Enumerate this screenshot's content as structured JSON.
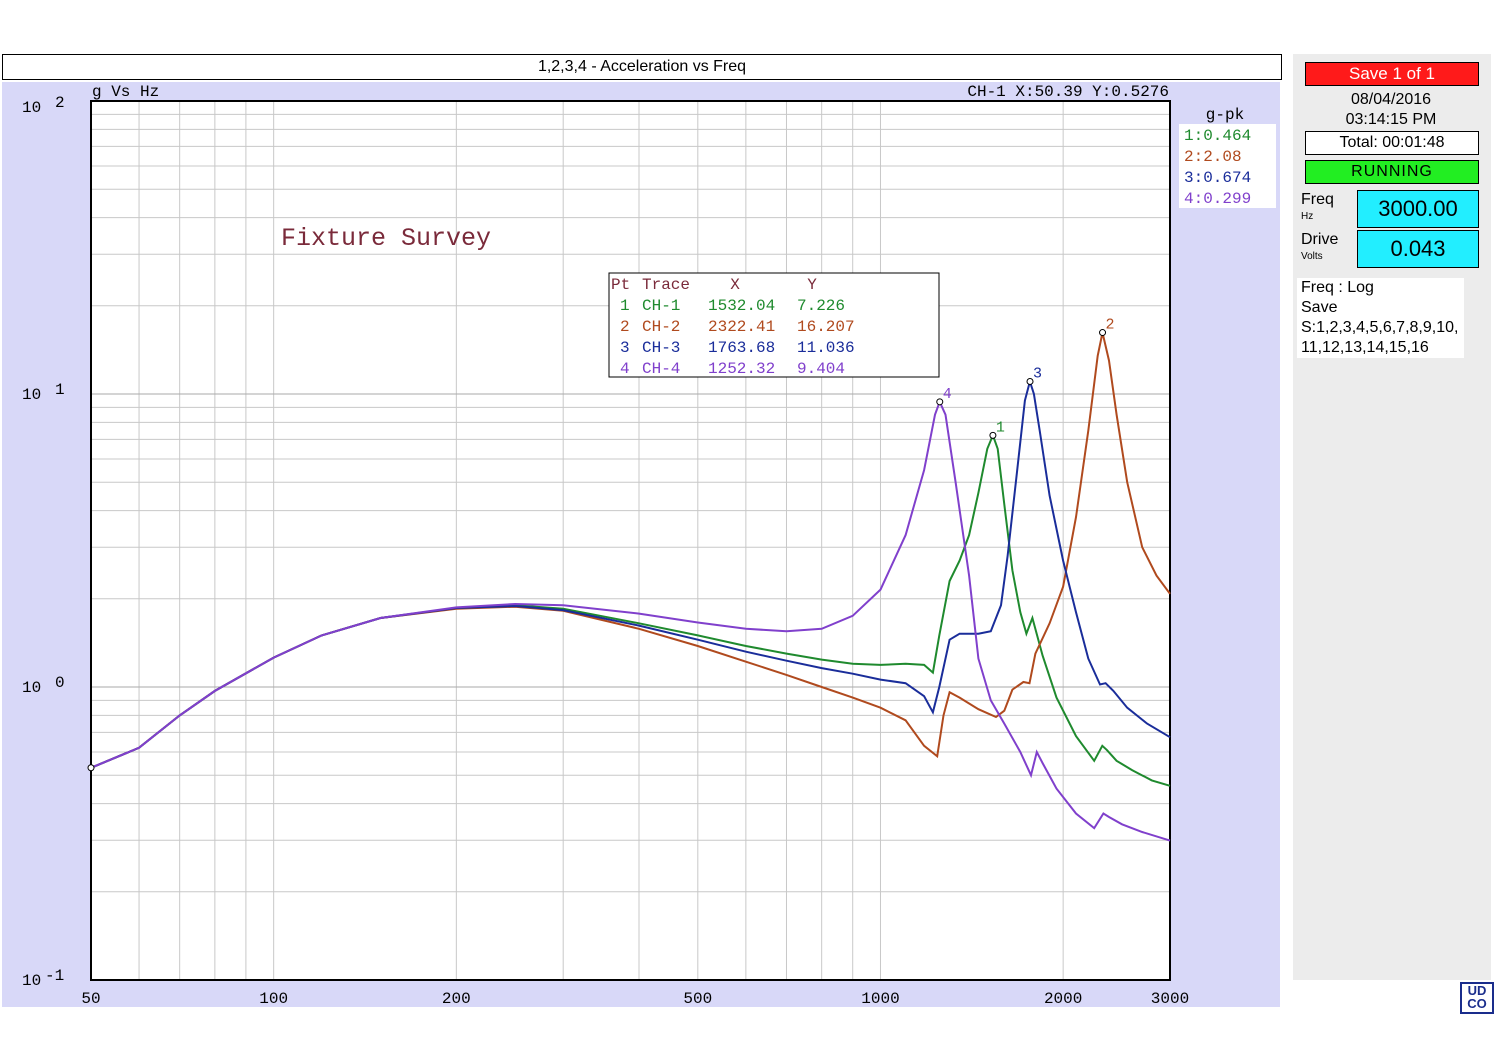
{
  "window_title": "1,2,3,4 - Acceleration vs Freq",
  "chart_data": {
    "type": "line",
    "xscale": "log",
    "yscale": "log",
    "xlim": [
      50,
      3000
    ],
    "ylim": [
      0.1,
      100
    ],
    "xticks": [
      "50",
      "100",
      "200",
      "500",
      "1000",
      "2000",
      "3000"
    ],
    "yticks": [
      {
        "base": "10",
        "exp": "-1"
      },
      {
        "base": "10",
        "exp": "0"
      },
      {
        "base": "10",
        "exp": "1"
      },
      {
        "base": "10",
        "exp": "2"
      }
    ],
    "axis_title": "g Vs Hz",
    "cursor_readout": "CH-1 X:50.39 Y:0.5276",
    "annotation": "Fixture Survey",
    "grid": true,
    "legend": {
      "title": "g-pk",
      "placement": "right",
      "entries": [
        "1:0.464",
        "2:2.08",
        "3:0.674",
        "4:0.299"
      ]
    },
    "peak_table": {
      "headers": [
        "Pt",
        "Trace",
        "X",
        "Y"
      ],
      "rows": [
        [
          "1",
          "CH-1",
          "1532.04",
          "7.226"
        ],
        [
          "2",
          "CH-2",
          "2322.41",
          "16.207"
        ],
        [
          "3",
          "CH-3",
          "1763.68",
          "11.036"
        ],
        [
          "4",
          "CH-4",
          "1252.32",
          "9.404"
        ]
      ]
    },
    "series": [
      {
        "name": "CH-1",
        "color": "#1f8a2e",
        "marker_label": "1",
        "points": [
          [
            50,
            0.53
          ],
          [
            60,
            0.62
          ],
          [
            70,
            0.8
          ],
          [
            80,
            0.97
          ],
          [
            100,
            1.26
          ],
          [
            120,
            1.5
          ],
          [
            150,
            1.72
          ],
          [
            200,
            1.86
          ],
          [
            250,
            1.9
          ],
          [
            300,
            1.85
          ],
          [
            400,
            1.65
          ],
          [
            500,
            1.5
          ],
          [
            600,
            1.38
          ],
          [
            700,
            1.3
          ],
          [
            800,
            1.24
          ],
          [
            900,
            1.2
          ],
          [
            1000,
            1.19
          ],
          [
            1100,
            1.2
          ],
          [
            1180,
            1.19
          ],
          [
            1220,
            1.12
          ],
          [
            1250,
            1.5
          ],
          [
            1300,
            2.3
          ],
          [
            1350,
            2.7
          ],
          [
            1400,
            3.3
          ],
          [
            1450,
            4.6
          ],
          [
            1500,
            6.5
          ],
          [
            1532,
            7.226
          ],
          [
            1560,
            6.5
          ],
          [
            1600,
            4.2
          ],
          [
            1650,
            2.5
          ],
          [
            1700,
            1.8
          ],
          [
            1740,
            1.52
          ],
          [
            1780,
            1.72
          ],
          [
            1850,
            1.28
          ],
          [
            1950,
            0.92
          ],
          [
            2100,
            0.68
          ],
          [
            2250,
            0.56
          ],
          [
            2320,
            0.63
          ],
          [
            2360,
            0.61
          ],
          [
            2450,
            0.56
          ],
          [
            2600,
            0.52
          ],
          [
            2800,
            0.48
          ],
          [
            3000,
            0.46
          ]
        ]
      },
      {
        "name": "CH-2",
        "color": "#b04a1e",
        "marker_label": "2",
        "points": [
          [
            50,
            0.53
          ],
          [
            60,
            0.62
          ],
          [
            70,
            0.8
          ],
          [
            80,
            0.97
          ],
          [
            100,
            1.26
          ],
          [
            120,
            1.5
          ],
          [
            150,
            1.72
          ],
          [
            200,
            1.85
          ],
          [
            250,
            1.88
          ],
          [
            300,
            1.82
          ],
          [
            400,
            1.58
          ],
          [
            500,
            1.38
          ],
          [
            600,
            1.22
          ],
          [
            700,
            1.1
          ],
          [
            800,
            1.0
          ],
          [
            900,
            0.92
          ],
          [
            1000,
            0.85
          ],
          [
            1100,
            0.77
          ],
          [
            1180,
            0.63
          ],
          [
            1240,
            0.58
          ],
          [
            1270,
            0.8
          ],
          [
            1300,
            0.96
          ],
          [
            1350,
            0.92
          ],
          [
            1450,
            0.84
          ],
          [
            1550,
            0.79
          ],
          [
            1600,
            0.83
          ],
          [
            1650,
            0.98
          ],
          [
            1720,
            1.04
          ],
          [
            1760,
            1.03
          ],
          [
            1800,
            1.3
          ],
          [
            1900,
            1.65
          ],
          [
            2000,
            2.2
          ],
          [
            2100,
            3.8
          ],
          [
            2200,
            7.5
          ],
          [
            2280,
            13.5
          ],
          [
            2322,
            16.207
          ],
          [
            2380,
            13.0
          ],
          [
            2450,
            8.5
          ],
          [
            2550,
            5.0
          ],
          [
            2700,
            3.0
          ],
          [
            2850,
            2.4
          ],
          [
            3000,
            2.08
          ]
        ]
      },
      {
        "name": "CH-3",
        "color": "#1a2d9a",
        "marker_label": "3",
        "points": [
          [
            50,
            0.53
          ],
          [
            60,
            0.62
          ],
          [
            70,
            0.8
          ],
          [
            80,
            0.97
          ],
          [
            100,
            1.26
          ],
          [
            120,
            1.5
          ],
          [
            150,
            1.72
          ],
          [
            200,
            1.86
          ],
          [
            250,
            1.89
          ],
          [
            300,
            1.83
          ],
          [
            400,
            1.62
          ],
          [
            500,
            1.45
          ],
          [
            600,
            1.32
          ],
          [
            700,
            1.23
          ],
          [
            800,
            1.16
          ],
          [
            900,
            1.11
          ],
          [
            1000,
            1.06
          ],
          [
            1100,
            1.03
          ],
          [
            1180,
            0.93
          ],
          [
            1220,
            0.82
          ],
          [
            1250,
            1.0
          ],
          [
            1300,
            1.45
          ],
          [
            1350,
            1.52
          ],
          [
            1450,
            1.52
          ],
          [
            1520,
            1.55
          ],
          [
            1580,
            1.9
          ],
          [
            1620,
            2.8
          ],
          [
            1680,
            5.5
          ],
          [
            1730,
            9.5
          ],
          [
            1763,
            11.036
          ],
          [
            1790,
            10.0
          ],
          [
            1830,
            7.5
          ],
          [
            1900,
            4.5
          ],
          [
            2000,
            2.7
          ],
          [
            2100,
            1.8
          ],
          [
            2200,
            1.25
          ],
          [
            2300,
            1.02
          ],
          [
            2350,
            1.03
          ],
          [
            2420,
            0.97
          ],
          [
            2550,
            0.85
          ],
          [
            2750,
            0.75
          ],
          [
            3000,
            0.674
          ]
        ]
      },
      {
        "name": "CH-4",
        "color": "#8040cc",
        "marker_label": "4",
        "points": [
          [
            50,
            0.53
          ],
          [
            60,
            0.62
          ],
          [
            70,
            0.8
          ],
          [
            80,
            0.97
          ],
          [
            100,
            1.26
          ],
          [
            120,
            1.5
          ],
          [
            150,
            1.72
          ],
          [
            200,
            1.87
          ],
          [
            250,
            1.92
          ],
          [
            300,
            1.9
          ],
          [
            400,
            1.78
          ],
          [
            500,
            1.66
          ],
          [
            600,
            1.58
          ],
          [
            700,
            1.55
          ],
          [
            800,
            1.58
          ],
          [
            900,
            1.75
          ],
          [
            1000,
            2.15
          ],
          [
            1100,
            3.3
          ],
          [
            1180,
            5.5
          ],
          [
            1230,
            8.5
          ],
          [
            1252,
            9.404
          ],
          [
            1280,
            8.5
          ],
          [
            1330,
            5.0
          ],
          [
            1400,
            2.4
          ],
          [
            1450,
            1.25
          ],
          [
            1520,
            0.9
          ],
          [
            1600,
            0.75
          ],
          [
            1700,
            0.6
          ],
          [
            1770,
            0.5
          ],
          [
            1810,
            0.6
          ],
          [
            1850,
            0.55
          ],
          [
            1950,
            0.45
          ],
          [
            2100,
            0.37
          ],
          [
            2250,
            0.33
          ],
          [
            2330,
            0.37
          ],
          [
            2380,
            0.36
          ],
          [
            2500,
            0.34
          ],
          [
            2700,
            0.32
          ],
          [
            3000,
            0.299
          ]
        ]
      }
    ]
  },
  "side": {
    "save_label": "Save   1 of   1",
    "date": "08/04/2016",
    "time": "03:14:15 PM",
    "total": "Total: 00:01:48",
    "status": "RUNNING",
    "freq_label": "Freq",
    "freq_unit": "Hz",
    "freq_value": "3000.00",
    "drive_label": "Drive",
    "drive_unit": "Volts",
    "drive_value": "0.043",
    "info_lines": [
      "Freq : Log",
      "Save",
      "S:1,2,3,4,5,6,7,8,9,10,",
      "11,12,13,14,15,16"
    ],
    "logo_top": "UD",
    "logo_bottom": "CO"
  },
  "colors": {
    "panel_bg": "#d8d8f8",
    "running": "#22ee22",
    "save": "#ff1a1a",
    "readout": "#22eeff"
  }
}
